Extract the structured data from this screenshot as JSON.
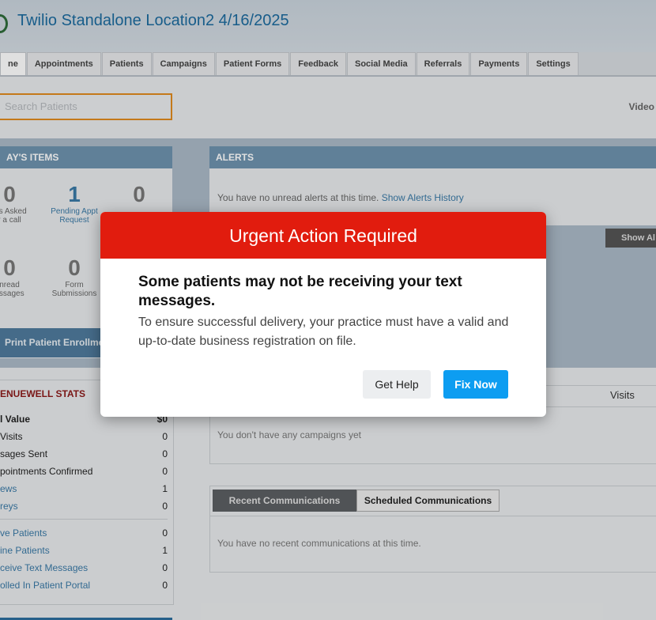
{
  "header": {
    "title": "Twilio Standalone Location2 4/16/2025"
  },
  "nav": {
    "tabs": [
      "ne",
      "Appointments",
      "Patients",
      "Campaigns",
      "Patient Forms",
      "Feedback",
      "Social Media",
      "Referrals",
      "Payments",
      "Settings"
    ]
  },
  "search": {
    "placeholder": "Search Patients"
  },
  "video_label": "Video",
  "today": {
    "title": "AY'S ITEMS",
    "stats": [
      {
        "value": "0",
        "label1": "nts Asked",
        "label2": "r a call"
      },
      {
        "value": "1",
        "label1": "Pending Appt",
        "label2": "Request"
      },
      {
        "value": "0",
        "label1": "",
        "label2": ""
      },
      {
        "value": "0",
        "label1": "nread",
        "label2": "essages"
      },
      {
        "value": "0",
        "label1": "Form",
        "label2": "Submissions"
      }
    ],
    "print_label": "Print Patient Enrollme"
  },
  "alerts": {
    "title": "ALERTS",
    "text": "You have no unread alerts at this time.",
    "link": "Show Alerts History",
    "show_all": "Show Al"
  },
  "stats": {
    "title": "ENUEWELL STATS",
    "rows": [
      {
        "k": "l Value",
        "v": "$0"
      },
      {
        "k": " Visits",
        "v": "0"
      },
      {
        "k": "sages Sent",
        "v": "0"
      },
      {
        "k": "pointments Confirmed",
        "v": "0"
      },
      {
        "k": "ews",
        "v": "1"
      },
      {
        "k": "reys",
        "v": "0"
      },
      {
        "k": "ve Patients",
        "v": "0"
      },
      {
        "k": "ine Patients",
        "v": "1"
      },
      {
        "k": "ceive Text Messages",
        "v": "0"
      },
      {
        "k": "olled In Patient Portal",
        "v": "0"
      }
    ]
  },
  "campaigns": {
    "visits_header": "Visits",
    "empty": "You don't have any campaigns yet"
  },
  "communications": {
    "tab_recent": "Recent Communications",
    "tab_scheduled": "Scheduled Communications",
    "empty": "You have no recent communications at this time."
  },
  "modal": {
    "title": "Urgent Action Required",
    "heading": "Some patients may not be receiving your text messages.",
    "body": "To ensure successful delivery, your practice must have a valid and up-to-date business registration on file.",
    "help_label": "Get Help",
    "fix_label": "Fix Now"
  }
}
